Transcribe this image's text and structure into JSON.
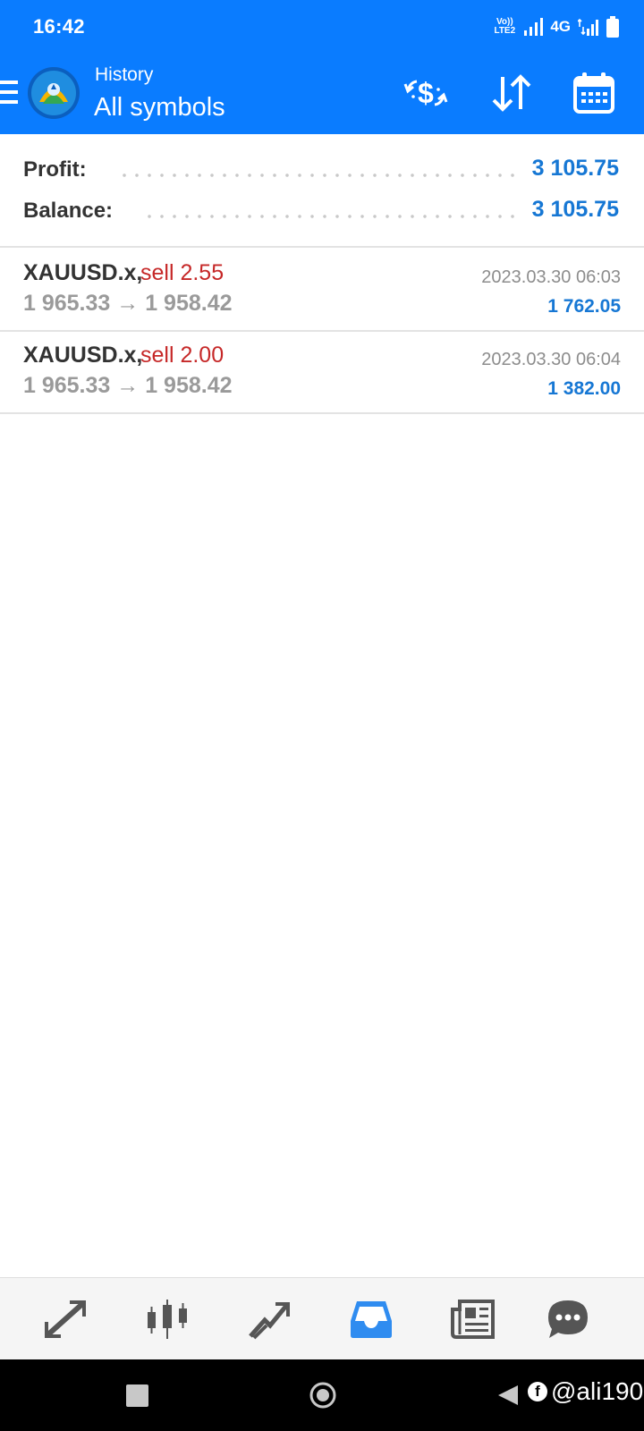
{
  "status_bar": {
    "time": "16:42",
    "volte": "Vo))",
    "lte": "LTE2",
    "network": "4G"
  },
  "header": {
    "subtitle": "History",
    "title": "All symbols",
    "accent_color": "#0a7cff"
  },
  "summary": {
    "profit_label": "Profit:",
    "profit_value": "3 105.75",
    "balance_label": "Balance:",
    "balance_value": "3 105.75"
  },
  "deals": [
    {
      "symbol": "XAUUSD.x,",
      "type": "sell 2.55",
      "prices": "1 965.33 → 1 958.42",
      "time": "2023.03.30 06:03",
      "profit": "1 762.05"
    },
    {
      "symbol": "XAUUSD.x,",
      "type": "sell 2.00",
      "prices": "1 965.33 → 1 958.42",
      "time": "2023.03.30 06:04",
      "profit": "1 382.00"
    }
  ],
  "tabs": [
    {
      "icon": "quotes-icon",
      "active": false
    },
    {
      "icon": "chart-icon",
      "active": false
    },
    {
      "icon": "trade-icon",
      "active": false
    },
    {
      "icon": "history-icon",
      "active": true
    },
    {
      "icon": "news-icon",
      "active": false
    },
    {
      "icon": "chat-icon",
      "active": false
    }
  ],
  "nav": {
    "watermark": "@ali190"
  }
}
